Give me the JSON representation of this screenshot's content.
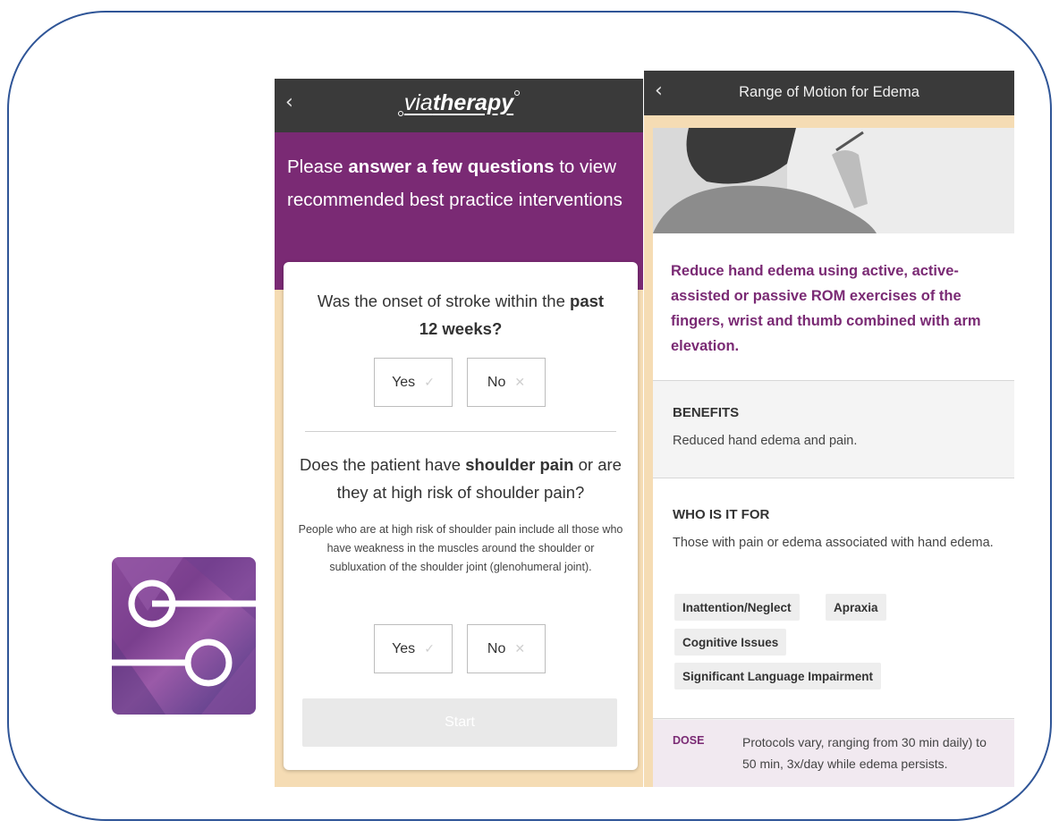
{
  "screen1": {
    "brand_via": "via",
    "brand_therapy": "therapy",
    "back_glyph": "‹",
    "intro_part1": "Please ",
    "intro_bold": "answer a few questions",
    "intro_part2": " to view recommended best practice interventions",
    "q1_part1": "Was the onset of stroke within the ",
    "q1_bold": "past 12 weeks?",
    "q2_part1": "Does the patient have ",
    "q2_bold": "shoulder pain",
    "q2_part2": " or are they at high risk of shoulder pain?",
    "q2_note": "People who are at high risk of shoulder pain include all those who have weakness in the muscles around the shoulder or subluxation of the shoulder joint (glenohumeral joint).",
    "yes_label": "Yes",
    "no_label": "No",
    "check_glyph": "✓",
    "cross_glyph": "✕",
    "start_label": "Start"
  },
  "screen2": {
    "back_glyph": "‹",
    "title": "Range of Motion for Edema",
    "lead": "Reduce hand edema using active, active-assisted or passive ROM exercises of the fingers, wrist and thumb combined with arm elevation.",
    "benefits_heading": "BENEFITS",
    "benefits_text": "Reduced hand edema and pain.",
    "who_heading": "WHO IS IT FOR",
    "who_text": "Those with pain or edema associated with hand edema.",
    "tags": [
      "Inattention/Neglect",
      "Apraxia",
      "Cognitive Issues",
      "Significant Language Impairment"
    ],
    "dose_label": "DOSE",
    "dose_text": "Protocols vary, ranging from 30 min daily) to 50 min, 3x/day while edema persists."
  },
  "colors": {
    "frame_border": "#2f5597",
    "header_dark": "#3a3a3a",
    "brand_purple": "#7a2a74",
    "peach_bg": "#f5dcb4"
  },
  "icons": {
    "app_icon": "sliders-icon",
    "back": "chevron-left-icon",
    "yes": "check-icon",
    "no": "close-icon"
  }
}
